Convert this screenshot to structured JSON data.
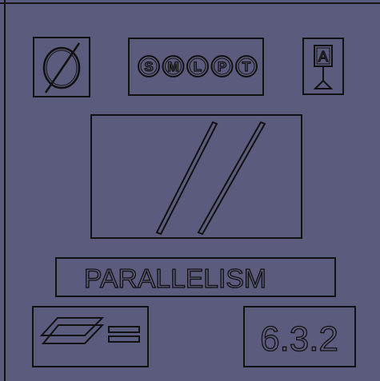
{
  "title": "PARALLELISM",
  "code": "6.3.2",
  "size_letters": [
    "S",
    "M",
    "L",
    "P",
    "T"
  ],
  "datum_letter": "A",
  "icons": {
    "diameter": "diameter-symbol-icon",
    "datum": "datum-target-icon",
    "parallel": "parallel-lines-icon",
    "flat_equals": "parallel-planes-equals-icon"
  },
  "colors": {
    "background": "#5b5b7d",
    "outline": "#111111"
  }
}
